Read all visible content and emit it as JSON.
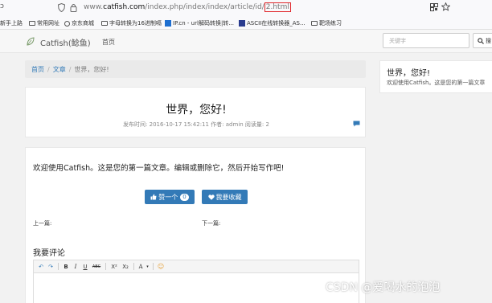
{
  "browser": {
    "nav_glyph": "ↄ",
    "url_prefix": "www.",
    "url_domain": "catfish.com",
    "url_path": "/index.php/index/index/article/id/",
    "url_highlight": "2.html"
  },
  "bookmarks": [
    {
      "label": "新手上路",
      "icon": "fire-icon"
    },
    {
      "label": "常用网址",
      "icon": "folder-icon"
    },
    {
      "label": "京东商城",
      "icon": "globe-icon"
    },
    {
      "label": "字母转换为16进制嗝",
      "icon": "folder-icon"
    },
    {
      "label": "IP.cn - url解码转换|转...",
      "icon": "ip-icon"
    },
    {
      "label": "ASCII在线转换器_AS...",
      "icon": "ascii-icon"
    },
    {
      "label": "靶场练习",
      "icon": "folder-icon"
    }
  ],
  "site": {
    "name": "Catfish(鲶鱼)",
    "home": "首页",
    "search_placeholder": "关键字",
    "search_button": "搜"
  },
  "breadcrumb": {
    "home": "首页",
    "sep": "/",
    "category": "文章",
    "current": "世界，您好!"
  },
  "article": {
    "title": "世界，您好!",
    "meta": "发布时间: 2016-10-17 15:42:11 作者: admin 阅读量: 2",
    "content": "欢迎使用Catfish。这是您的第一篇文章。编辑或删除它，然后开始写作吧!",
    "like_label": "赞一个",
    "like_count": "0",
    "fav_label": "我要收藏",
    "prev_label": "上一篇:",
    "next_label": "下一篇:"
  },
  "comments": {
    "heading": "我要评论",
    "toolbar": [
      "B",
      "I",
      "U",
      "ABC",
      "X²",
      "X₂",
      "A",
      "☺"
    ]
  },
  "sidebar": {
    "title": "世界，您好!",
    "text": "欢迎使用Catfish。这是您的第一篇文章"
  },
  "watermark": "CSDN @爱喝水的泡泡",
  "colors": {
    "accent": "#337ab7",
    "highlight_box": "#e0262a",
    "link": "#337ab7"
  }
}
